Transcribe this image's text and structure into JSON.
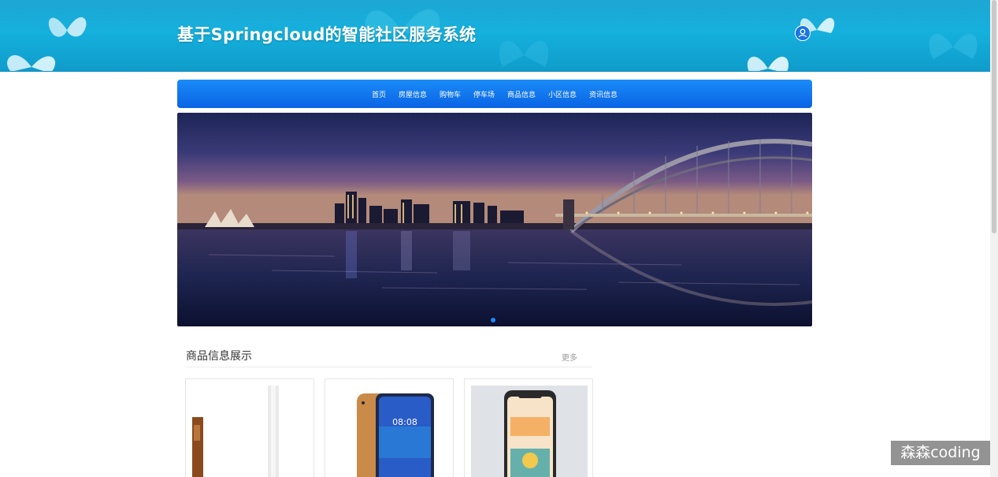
{
  "header": {
    "site_title": "基于Springcloud的智能社区服务系统",
    "user_icon": "user-icon"
  },
  "nav": {
    "items": [
      {
        "label": "首页"
      },
      {
        "label": "房屋信息"
      },
      {
        "label": "购物车"
      },
      {
        "label": "停车场"
      },
      {
        "label": "商品信息"
      },
      {
        "label": "小区信息"
      },
      {
        "label": "资讯信息"
      }
    ]
  },
  "banner": {
    "slide_count": 1,
    "active_slide": 1
  },
  "products": {
    "title": "商品信息展示",
    "more_label": "更多",
    "phone_time": "08:08"
  },
  "watermark": "森森coding",
  "colors": {
    "header": "#15b0dd",
    "nav": "#0a63e4",
    "accent": "#1a8cf8"
  }
}
